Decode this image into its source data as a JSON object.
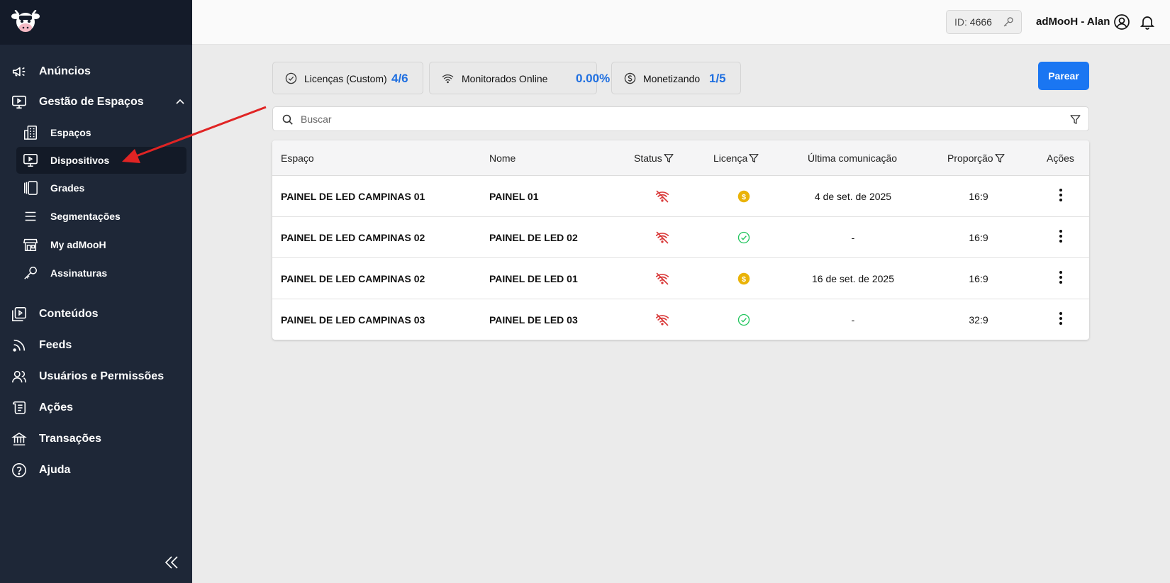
{
  "sidebar": {
    "nav": {
      "anuncios": "Anúncios",
      "gestao": "Gestão de Espaços",
      "conteudos": "Conteúdos",
      "feeds": "Feeds",
      "usuarios": "Usuários e Permissões",
      "acoes": "Ações",
      "transacoes": "Transações",
      "ajuda": "Ajuda"
    },
    "sub": {
      "espacos": "Espaços",
      "dispositivos": "Dispositivos",
      "grades": "Grades",
      "segmentacoes": "Segmentações",
      "myadmooh": "My adMooH",
      "assinaturas": "Assinaturas"
    }
  },
  "header": {
    "id_label": "ID:",
    "id_value": "4666",
    "user_name": "adMooH - Alan"
  },
  "stats": {
    "licencas_label": "Licenças (Custom)",
    "licencas_value": "4/6",
    "monitorados_label": "Monitorados Online",
    "monitorados_value": "0.00%",
    "monetizando_label": "Monetizando",
    "monetizando_value": "1/5"
  },
  "actions": {
    "parear": "Parear"
  },
  "search": {
    "placeholder": "Buscar"
  },
  "table": {
    "headers": {
      "espaco": "Espaço",
      "nome": "Nome",
      "status": "Status",
      "licenca": "Licença",
      "ultima": "Última comunicação",
      "proporcao": "Proporção",
      "acoes": "Ações"
    },
    "rows": [
      {
        "espaco": "PAINEL DE LED CAMPINAS 01",
        "nome": "PAINEL 01",
        "status": "offline",
        "licenca": "monetizing",
        "ultima": "4 de set. de 2025",
        "proporcao": "16:9"
      },
      {
        "espaco": "PAINEL DE LED CAMPINAS 02",
        "nome": "PAINEL DE LED 02",
        "status": "offline",
        "licenca": "licensed",
        "ultima": "-",
        "proporcao": "16:9"
      },
      {
        "espaco": "PAINEL DE LED CAMPINAS 02",
        "nome": "PAINEL DE LED 01",
        "status": "offline",
        "licenca": "monetizing",
        "ultima": "16 de set. de 2025",
        "proporcao": "16:9"
      },
      {
        "espaco": "PAINEL DE LED CAMPINAS 03",
        "nome": "PAINEL DE LED 03",
        "status": "offline",
        "licenca": "licensed",
        "ultima": "-",
        "proporcao": "32:9"
      }
    ]
  },
  "colors": {
    "sidebar_bg": "#1e2737",
    "accent": "#1a76f2",
    "stat_value": "#1f6fe0",
    "offline_red": "#d93a3a",
    "coin_gold": "#eab308",
    "check_green": "#22c55e",
    "annotation_red": "#e02424"
  },
  "icons": {
    "status_offline": "wifi-off-icon",
    "licenca_monetizing": "coin-dollar-icon",
    "licenca_licensed": "check-circle-icon",
    "row_actions": "kebab-menu-icon"
  }
}
